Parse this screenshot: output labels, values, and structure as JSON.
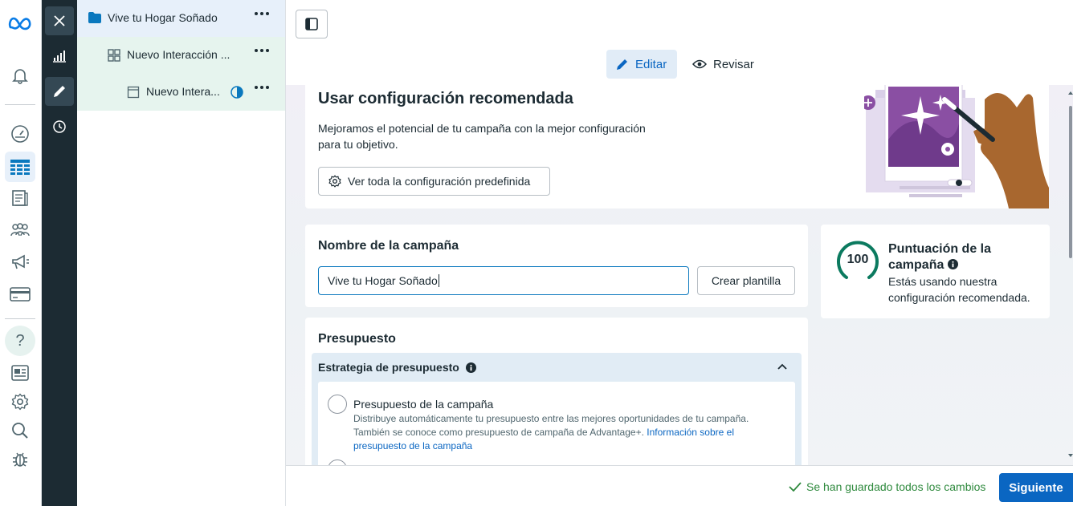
{
  "rail": {
    "logo_icon": "meta-logo-icon",
    "items": [
      "notifications-bell-icon",
      "dashboard-gauge-icon",
      "ads-manager-table-icon",
      "catalog-icon",
      "audiences-icon",
      "campaigns-megaphone-icon",
      "billing-card-icon",
      "help-icon",
      "news-icon",
      "settings-gear-icon",
      "search-icon",
      "bug-report-icon"
    ],
    "help_glyph": "?"
  },
  "tools": {
    "close_icon": "close-icon",
    "chart_icon": "chart-icon",
    "edit_icon": "pencil-icon",
    "history_icon": "clock-icon"
  },
  "tree": {
    "campaign": "Vive tu Hogar Soñado",
    "adset": "Nuevo Interacción ...",
    "ad": "Nuevo Intera..."
  },
  "topbar": {
    "edit_label": "Editar",
    "review_label": "Revisar"
  },
  "recommended": {
    "title": "Usar configuración recomendada",
    "description": "Mejoramos el potencial de tu campaña con la mejor configuración para tu objetivo.",
    "button": "Ver toda la configuración predefinida"
  },
  "campaign_name": {
    "title": "Nombre de la campaña",
    "value": "Vive tu Hogar Soñado",
    "template_button": "Crear plantilla"
  },
  "score": {
    "value": "100",
    "title": "Puntuación de la campaña",
    "description": "Estás usando nuestra configuración recomendada."
  },
  "budget": {
    "title": "Presupuesto",
    "strategy_title": "Estrategia de presupuesto",
    "option_title": "Presupuesto de la campaña",
    "option_desc": "Distribuye automáticamente tu presupuesto entre las mejores oportunidades de tu campaña. También se conoce como presupuesto de campaña de Advantage+.",
    "option_link": "Información sobre el presupuesto de la campaña"
  },
  "footer": {
    "saved_text": "Se han guardado todos los cambios",
    "next_button": "Siguiente"
  },
  "colors": {
    "accent": "#0a78be",
    "primary_button": "#0a66c2",
    "success": "#2f8a3e",
    "score_ring": "#0b7a5f"
  }
}
